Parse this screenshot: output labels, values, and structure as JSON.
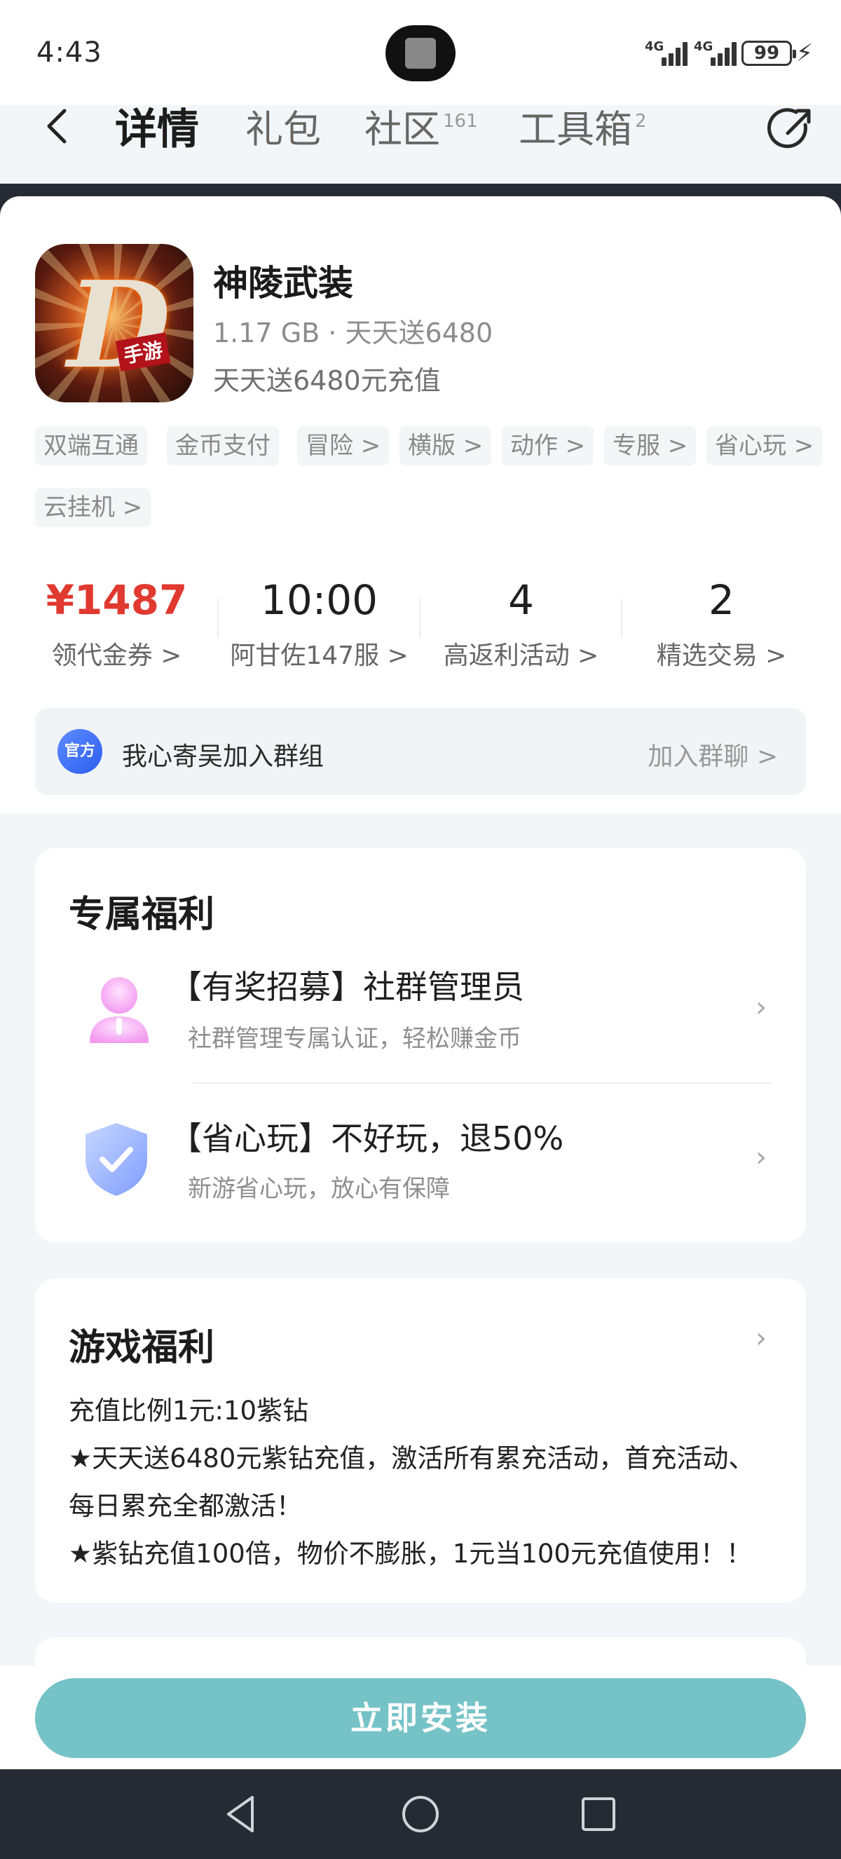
{
  "status_bar": {
    "time": "4:43",
    "network_1": "4G",
    "network_2": "4G",
    "battery": "99"
  },
  "nav": {
    "tabs": [
      {
        "label": "详情",
        "count": ""
      },
      {
        "label": "礼包",
        "count": ""
      },
      {
        "label": "社区",
        "count": "161"
      },
      {
        "label": "工具箱",
        "count": "2"
      }
    ],
    "active_tab": "详情"
  },
  "app": {
    "name": "神陵武装",
    "meta": "1.17 GB · 天天送6480",
    "promo": "天天送6480元充值",
    "icon_badge": "手游",
    "icon_letter": "D",
    "tags": [
      "双端互通",
      "金币支付",
      "冒险 >",
      "横版 >",
      "动作 >",
      "专服 >",
      "省心玩 >",
      "云挂机 >"
    ]
  },
  "stats": [
    {
      "value": "¥1487",
      "label": "领代金券 >"
    },
    {
      "value": "10:00",
      "label": "阿甘佐147服 >"
    },
    {
      "value": "4",
      "label": "高返利活动 >"
    },
    {
      "value": "2",
      "label": "精选交易 >"
    }
  ],
  "group": {
    "badge": "官方",
    "name": "我心寄吴加入群组",
    "action": "加入群聊 >"
  },
  "exclusive": {
    "title": "专属福利",
    "items": [
      {
        "title": "【有奖招募】社群管理员",
        "subtitle": "社群管理专属认证，轻松赚金币"
      },
      {
        "title": "【省心玩】不好玩，退50%",
        "subtitle": "新游省心玩，放心有保障"
      }
    ]
  },
  "game_benefits": {
    "title": "游戏福利",
    "lines": [
      "充值比例1元:10紫钻",
      "★天天送6480元紫钻充值，激活所有累充活动，首充活动、",
      "每日累充全都激活！",
      "★紫钻充值100倍，物价不膨胀，1元当100元充值使用！！"
    ]
  },
  "install_button": "立即安装",
  "colors": {
    "accent_red": "#e0392f",
    "install_button": "#75c2c7",
    "dark_bar": "#252a33"
  }
}
